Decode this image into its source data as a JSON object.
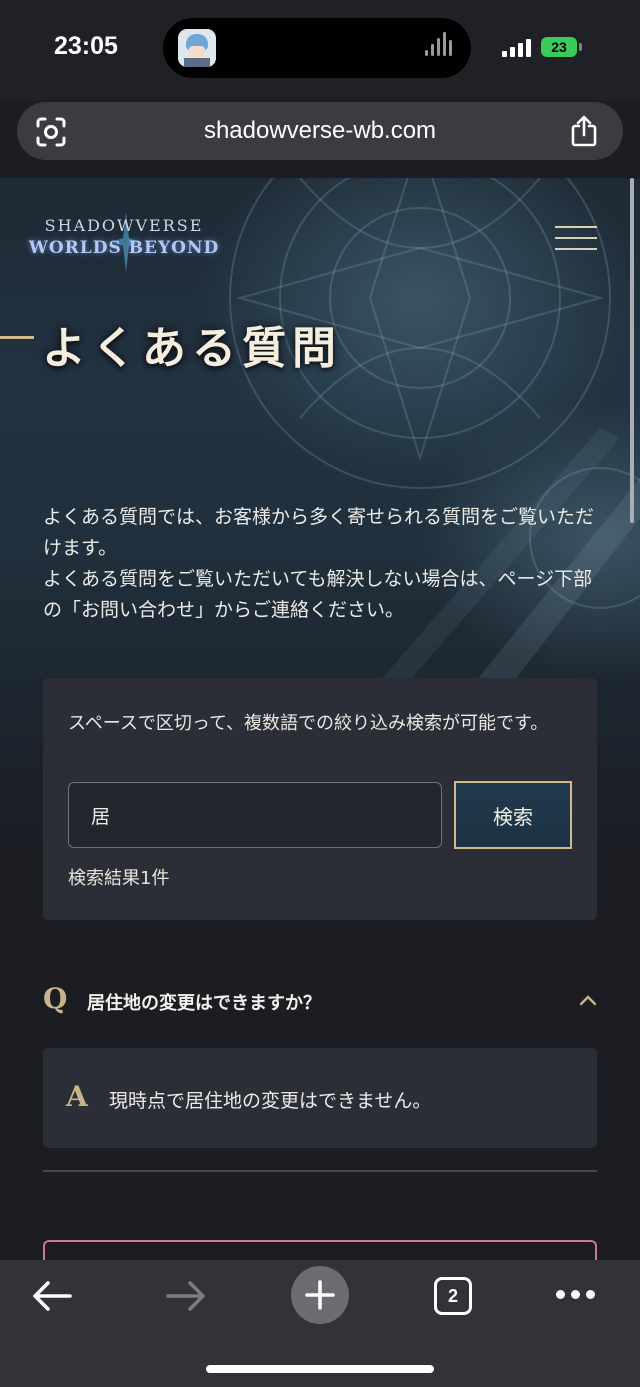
{
  "status_bar": {
    "time": "23:05",
    "battery": "23"
  },
  "browser": {
    "url": "shadowverse-wb.com",
    "open_tabs": "2"
  },
  "header": {
    "logo_top": "SHADOWVERSE",
    "logo_bottom": "WORLDS BEYOND"
  },
  "page": {
    "title": "よくある質問",
    "intro_line1": "よくある質問では、お客様から多く寄せられる質問をご覧いただけます。",
    "intro_line2": "よくある質問をご覧いただいても解決しない場合は、ページ下部の「お問い合わせ」からご連絡ください。"
  },
  "search": {
    "hint": "スペースで区切って、複数語での絞り込み検索が可能です。",
    "value": "居",
    "button_label": "検索",
    "result_count": "検索結果1件"
  },
  "faq": [
    {
      "q_mark": "Q",
      "question": "居住地の変更はできますか？",
      "a_mark": "A",
      "answer": "現時点で居住地の変更はできません。"
    }
  ],
  "icons": {
    "status_bar": [
      "now-playing-app-icon",
      "audio-wave-icon",
      "cellular-signal-icon",
      "battery-icon"
    ],
    "url_bar": [
      "scan-icon",
      "share-icon"
    ],
    "toolbar": [
      "back-arrow-icon",
      "forward-arrow-icon",
      "plus-icon",
      "tabs-icon",
      "more-icon"
    ],
    "page": [
      "hamburger-menu-icon",
      "chevron-up-icon"
    ]
  },
  "colors": {
    "accent_gold": "#c9b48a",
    "button_border": "#cdbb8d",
    "panel": "#2b2e36",
    "background": "#1b1d23",
    "battery_green": "#3bcb5d"
  }
}
